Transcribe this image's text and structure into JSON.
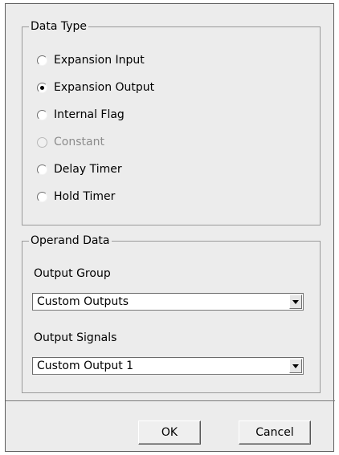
{
  "data_type": {
    "title": "Data Type",
    "options": [
      {
        "label": "Expansion Input",
        "selected": false,
        "disabled": false
      },
      {
        "label": "Expansion Output",
        "selected": true,
        "disabled": false
      },
      {
        "label": "Internal Flag",
        "selected": false,
        "disabled": false
      },
      {
        "label": "Constant",
        "selected": false,
        "disabled": true
      },
      {
        "label": "Delay Timer",
        "selected": false,
        "disabled": false
      },
      {
        "label": "Hold Timer",
        "selected": false,
        "disabled": false
      }
    ]
  },
  "operand_data": {
    "title": "Operand Data",
    "output_group_label": "Output Group",
    "output_group_value": "Custom Outputs",
    "output_signals_label": "Output Signals",
    "output_signals_value": "Custom Output 1"
  },
  "buttons": {
    "ok": "OK",
    "cancel": "Cancel"
  },
  "icons": {
    "dropdown": "chevron-down-icon"
  }
}
